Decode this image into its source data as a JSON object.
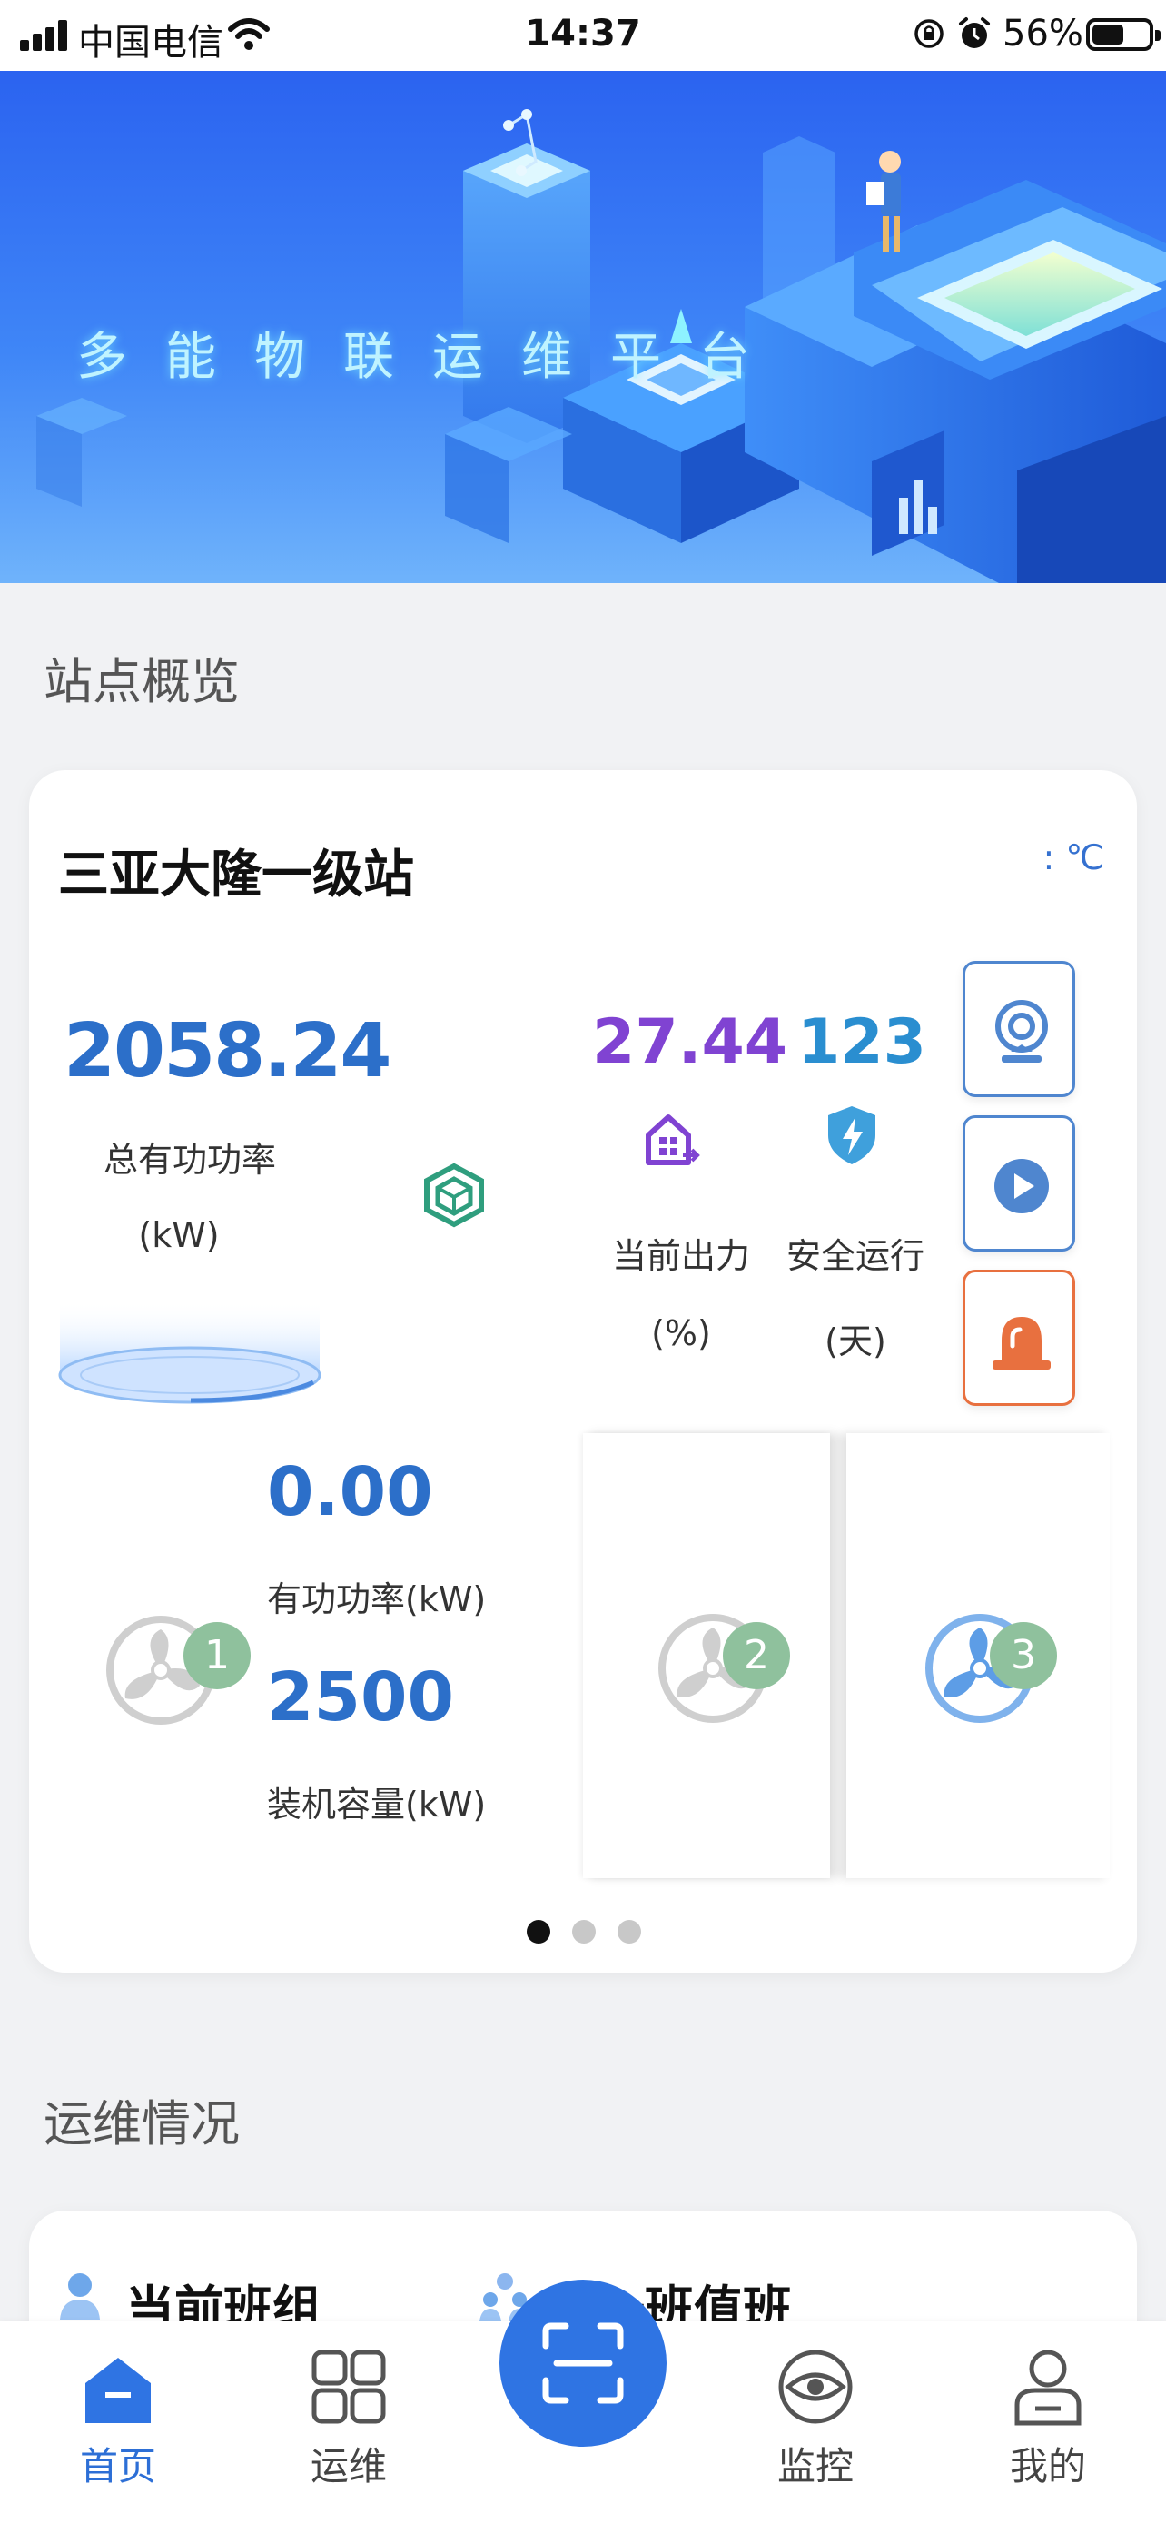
{
  "status_bar": {
    "carrier": "中国电信",
    "time": "14:37",
    "battery": "56%",
    "battery_level": 0.56
  },
  "banner": {
    "title": "多能物联运维平台"
  },
  "overview": {
    "section_title": "站点概览",
    "station_name": "三亚大隆一级站",
    "temperature": ": ℃",
    "total_power": {
      "value": "2058.24",
      "label": "总有功功率",
      "unit": "(kW)"
    },
    "current_output": {
      "value": "27.44",
      "label": "当前出力",
      "unit": "(%)"
    },
    "safe_days": {
      "value": "123",
      "label": "安全运行",
      "unit": "(天)"
    },
    "side_buttons": [
      "camera-icon",
      "play-icon",
      "alarm-icon"
    ],
    "generators": [
      {
        "id": "1",
        "active_power": "0.00",
        "active_power_label": "有功功率(kW)",
        "capacity": "2500",
        "capacity_label": "装机容量(kW)"
      },
      {
        "id": "2"
      },
      {
        "id": "3"
      }
    ],
    "carousel_pages": 3,
    "carousel_active": 1
  },
  "ops": {
    "section_title": "运维情况",
    "current_team": "当前班组",
    "next_shift": "下一班值班"
  },
  "tabbar": {
    "tabs": [
      {
        "label": "首页",
        "icon": "home-icon",
        "active": true
      },
      {
        "label": "运维",
        "icon": "grid-icon",
        "active": false
      },
      {
        "label": "",
        "icon": "scan-icon",
        "active": false
      },
      {
        "label": "监控",
        "icon": "eye-icon",
        "active": false
      },
      {
        "label": "我的",
        "icon": "user-icon",
        "active": false
      }
    ]
  },
  "colors": {
    "primary_blue": "#2f74e3",
    "value_blue": "#2c6fc9",
    "output_purple": "#8043d2",
    "safe_blue": "#2a8ed0",
    "alarm_orange": "#e8703f",
    "badge_green": "#8fc19d"
  }
}
